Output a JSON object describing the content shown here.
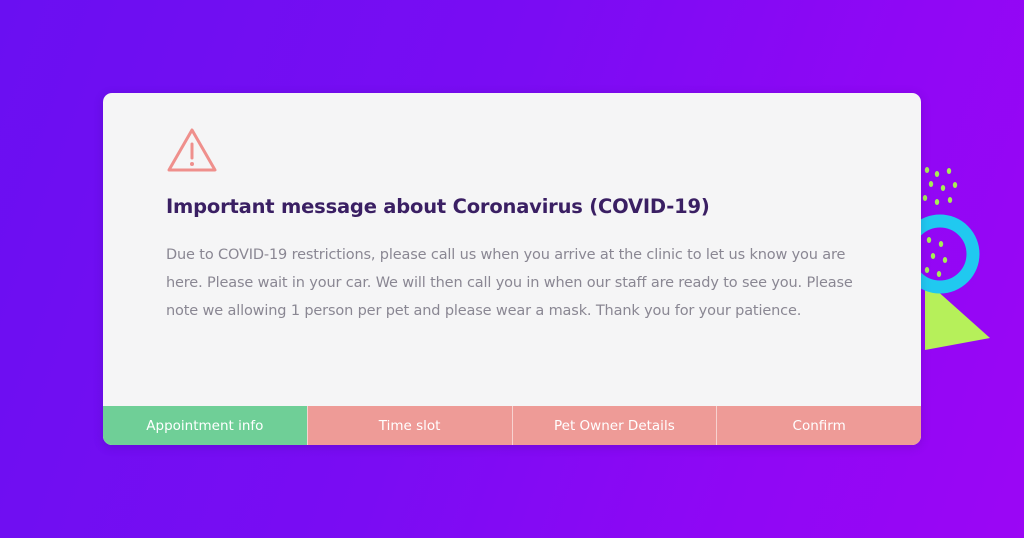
{
  "notice": {
    "title": "Important message about Coronavirus (COVID-19)",
    "message": "Due to COVID-19 restrictions, please call us when you arrive at the clinic to let us know you are here. Please wait in your car. We will then call you in when our staff are ready to see you. Please note we allowing 1 person per pet and please wear a mask. Thank you for your patience.",
    "icon": "warning-triangle-icon"
  },
  "steps": [
    {
      "label": "Appointment info",
      "active": true
    },
    {
      "label": "Time slot",
      "active": false
    },
    {
      "label": "Pet Owner Details",
      "active": false
    },
    {
      "label": "Confirm",
      "active": false
    }
  ],
  "colors": {
    "background_start": "#6a0ff2",
    "background_end": "#9b06f5",
    "card_background": "#f5f5f6",
    "title": "#3a1f63",
    "message": "#8a8793",
    "warning_icon": "#ef8f8c",
    "step_active": "#6fcf97",
    "step_inactive": "#ee9b97",
    "decor_ring": "#20c9f0",
    "decor_green": "#b6f05a"
  }
}
